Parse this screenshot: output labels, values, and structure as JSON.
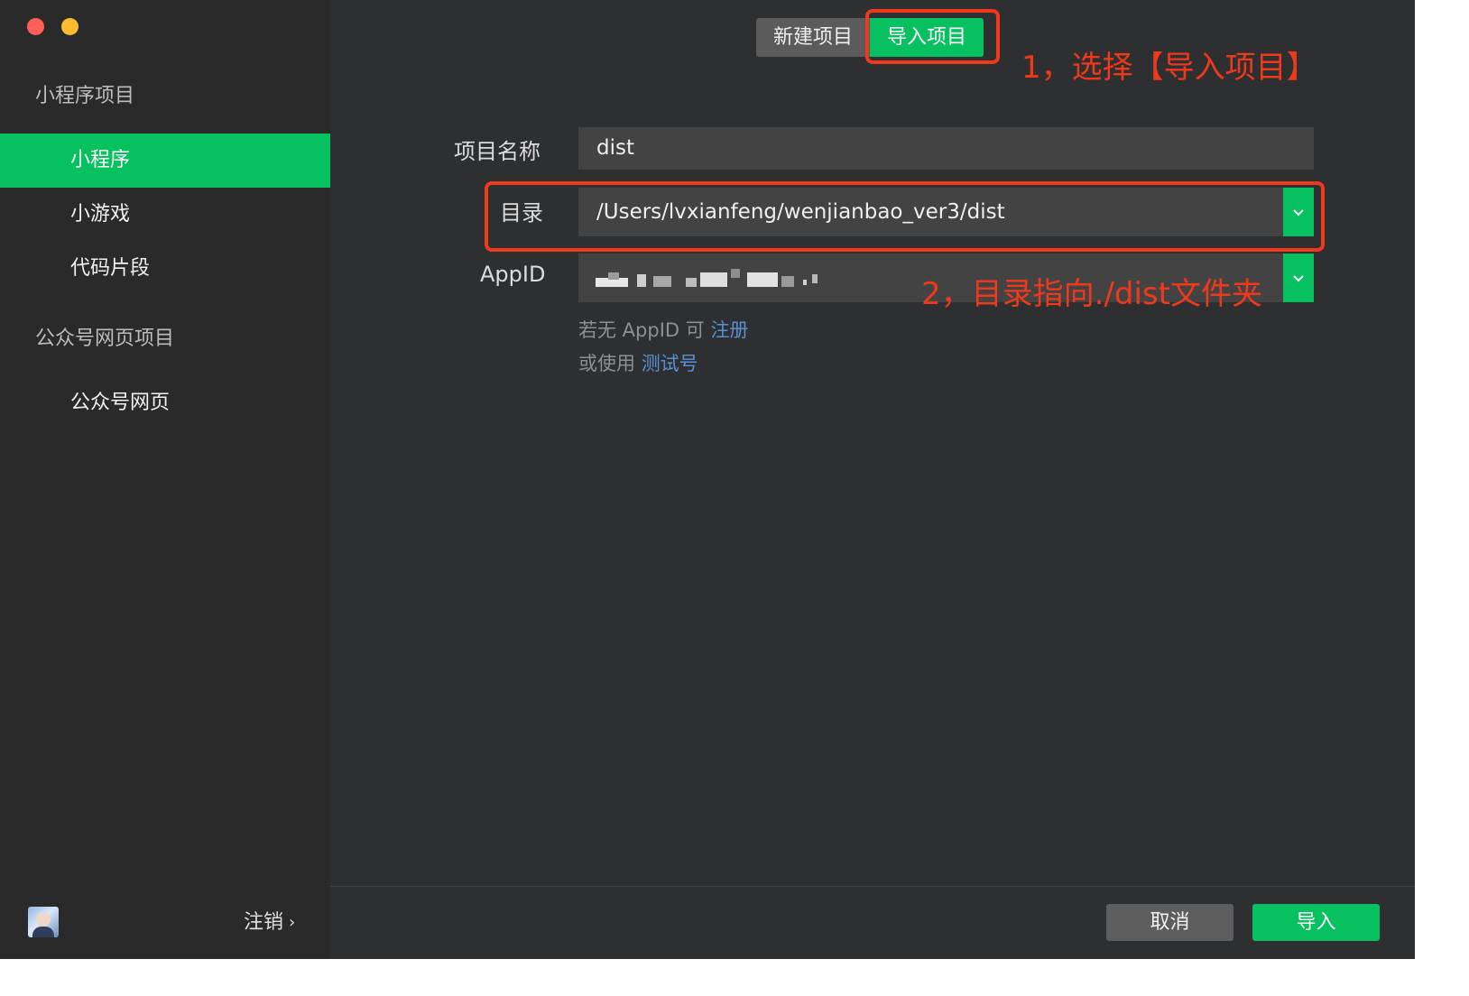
{
  "sidebar": {
    "section_miniprogram": "小程序项目",
    "items_miniprogram": [
      {
        "label": "小程序"
      },
      {
        "label": "小游戏"
      },
      {
        "label": "代码片段"
      }
    ],
    "section_official": "公众号网页项目",
    "items_official": [
      {
        "label": "公众号网页"
      }
    ],
    "logout_label": "注销"
  },
  "tabs": {
    "new_project": "新建项目",
    "import_project": "导入项目",
    "active": "导入项目"
  },
  "form": {
    "project_name_label": "项目名称",
    "project_name_value": "dist",
    "directory_label": "目录",
    "directory_value": "/Users/lvxianfeng/wenjianbao_ver3/dist",
    "appid_label": "AppID",
    "hint_no_appid": "若无 AppID 可",
    "hint_register": "注册",
    "hint_or_use": "或使用",
    "hint_test_account": "测试号"
  },
  "annotations": {
    "step1": "1，选择【导入项目】",
    "step2": "2，目录指向./dist文件夹"
  },
  "footer": {
    "cancel": "取消",
    "import": "导入"
  },
  "colors": {
    "accent_green": "#07c160",
    "annotation_red": "#f0391b",
    "link_blue": "#5a8fd6",
    "background": "#2e2f31"
  }
}
